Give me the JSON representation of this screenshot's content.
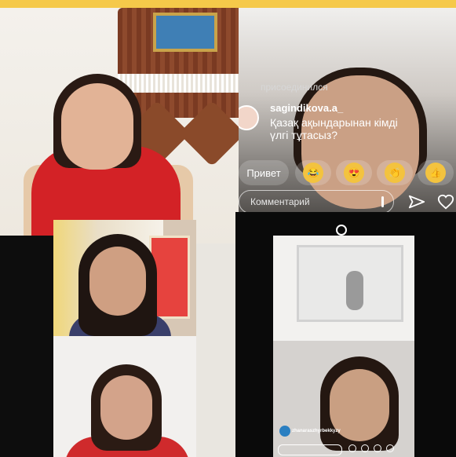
{
  "live_overlay": {
    "joined_text": "присоединился",
    "comment_user": "sagindikova.a_",
    "comment_text": "Қазақ ақындарынан кімді үлгі тұтасыз?",
    "reactions": [
      {
        "type": "text",
        "label": "Привет"
      },
      {
        "type": "emoji",
        "label": "😂"
      },
      {
        "type": "emoji",
        "label": "😍"
      },
      {
        "type": "emoji",
        "label": "👏"
      },
      {
        "type": "emoji",
        "label": "👍"
      }
    ],
    "comment_placeholder": "Комментарий"
  },
  "phone_screen": {
    "viewer_name": "zhanaraszhyrbekkyzy"
  },
  "icons": {
    "send": "send-icon",
    "heart": "heart-icon",
    "more": "more-options-icon",
    "home_circle": "home-circle-icon"
  },
  "colors": {
    "accent_top_bar": "#f5c94a",
    "dress_red": "#d32226",
    "emoji_yellow": "#f3c33f"
  }
}
